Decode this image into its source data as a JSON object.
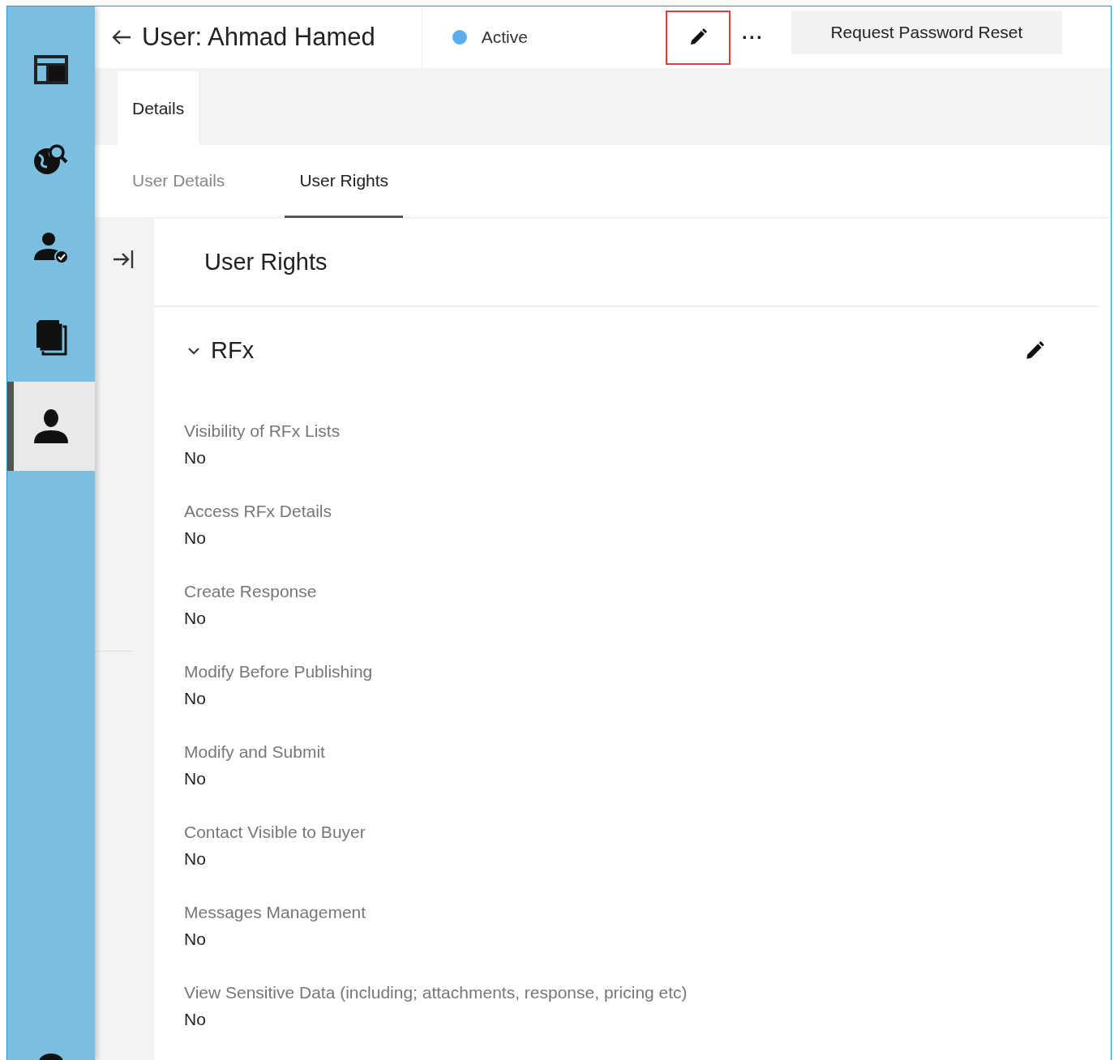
{
  "sidebar": {
    "items": [
      {
        "kind": "layout",
        "selected": false
      },
      {
        "kind": "globe-search",
        "selected": false
      },
      {
        "kind": "user-check",
        "selected": false
      },
      {
        "kind": "documents",
        "selected": false
      },
      {
        "kind": "user",
        "selected": true
      },
      {
        "kind": "partial",
        "selected": false
      }
    ]
  },
  "header": {
    "title": "User: Ahmad Hamed",
    "status": {
      "label": "Active",
      "color": "#5aaef0"
    },
    "edit_highlighted": true,
    "more": "···",
    "button": "Request Password Reset"
  },
  "tabs": [
    {
      "label": "Details",
      "selected": true
    }
  ],
  "subtabs": [
    {
      "label": "User Details",
      "selected": false
    },
    {
      "label": "User Rights",
      "selected": true
    }
  ],
  "panel": {
    "title": "User Rights",
    "section": {
      "title": "RFx",
      "expanded": true,
      "fields": [
        {
          "label": "Visibility of RFx Lists",
          "value": "No"
        },
        {
          "label": "Access RFx Details",
          "value": "No"
        },
        {
          "label": "Create Response",
          "value": "No"
        },
        {
          "label": "Modify Before Publishing",
          "value": "No"
        },
        {
          "label": "Modify and Submit",
          "value": "No"
        },
        {
          "label": "Contact Visible to Buyer",
          "value": "No"
        },
        {
          "label": "Messages Management",
          "value": "No"
        },
        {
          "label": "View Sensitive Data (including; attachments, response, pricing etc)",
          "value": "No"
        }
      ]
    }
  }
}
